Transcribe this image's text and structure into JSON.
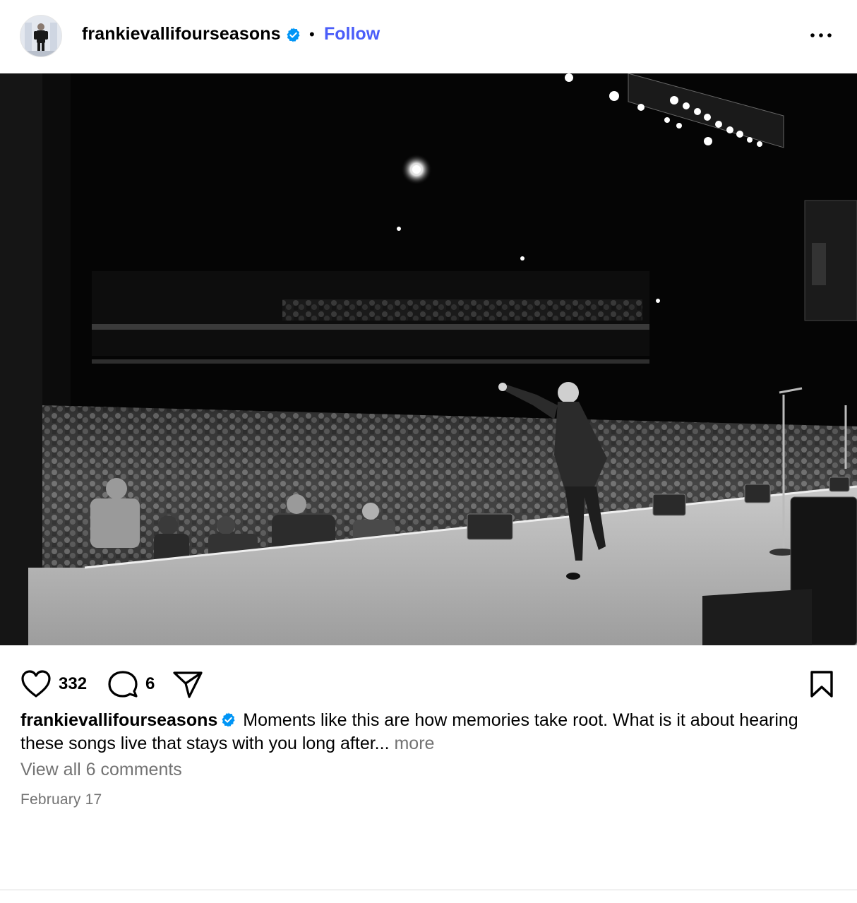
{
  "header": {
    "username": "frankievallifourseasons",
    "separator": "•",
    "follow_label": "Follow"
  },
  "photo": {
    "description_icon": "concert-stage-photo"
  },
  "actions": {
    "like_count": "332",
    "comment_count": "6"
  },
  "caption": {
    "username": "frankievallifourseasons",
    "text": "Moments like this are how memories take root. What is it about hearing these songs live that stays with you long after...",
    "more_label": "more"
  },
  "comments": {
    "view_all_label": "View all 6 comments"
  },
  "meta": {
    "date": "February 17"
  },
  "colors": {
    "follow_blue": "#4a5df9",
    "verified_blue": "#0095f6",
    "muted_gray": "#737373"
  }
}
